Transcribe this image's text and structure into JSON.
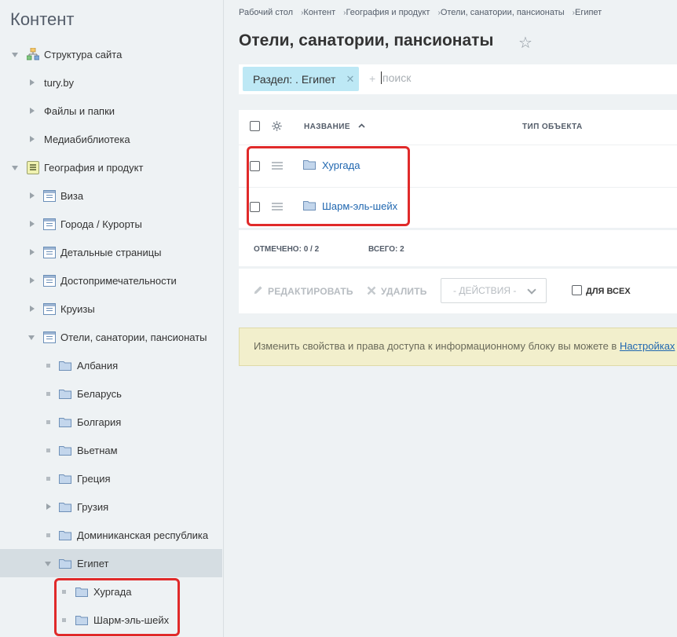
{
  "sidebar": {
    "title": "Контент",
    "items": [
      {
        "label": "Структура сайта",
        "icon": "site-structure-icon"
      },
      {
        "label": "tury.by"
      },
      {
        "label": "Файлы и папки"
      },
      {
        "label": "Медиабиблиотека"
      },
      {
        "label": "География и продукт",
        "icon": "infoblock-type-icon"
      },
      {
        "label": "Виза",
        "icon": "infoblock-list-icon"
      },
      {
        "label": "Города / Курорты",
        "icon": "infoblock-list-icon"
      },
      {
        "label": "Детальные страницы",
        "icon": "infoblock-list-icon"
      },
      {
        "label": "Достопримечательности",
        "icon": "infoblock-list-icon"
      },
      {
        "label": "Круизы",
        "icon": "infoblock-list-icon"
      },
      {
        "label": "Отели, санатории, пансионаты",
        "icon": "infoblock-list-icon"
      },
      {
        "label": "Албания",
        "icon": "folder-icon"
      },
      {
        "label": "Беларусь",
        "icon": "folder-icon"
      },
      {
        "label": "Болгария",
        "icon": "folder-icon"
      },
      {
        "label": "Вьетнам",
        "icon": "folder-icon"
      },
      {
        "label": "Греция",
        "icon": "folder-icon"
      },
      {
        "label": "Грузия",
        "icon": "folder-icon"
      },
      {
        "label": "Доминиканская республика",
        "icon": "folder-icon"
      },
      {
        "label": "Египет",
        "icon": "folder-icon"
      },
      {
        "label": "Хургада",
        "icon": "folder-icon"
      },
      {
        "label": "Шарм-эль-шейх",
        "icon": "folder-icon"
      }
    ]
  },
  "breadcrumb": [
    "Рабочий стол",
    "Контент",
    "География и продукт",
    "Отели, санатории, пансионаты",
    "Египет"
  ],
  "page": {
    "title": "Отели, санатории, пансионаты",
    "favorite_icon": "star-icon"
  },
  "filter": {
    "chip": "Раздел: . Египет",
    "plus": "+",
    "placeholder": "поиск"
  },
  "grid": {
    "columns": [
      "НАЗВАНИЕ",
      "ТИП ОБЪЕКТА"
    ],
    "rows": [
      {
        "name": "Хургада"
      },
      {
        "name": "Шарм-эль-шейх"
      }
    ],
    "footer": {
      "selected_label": "ОТМЕЧЕНО:",
      "selected_value": "0 / 2",
      "total_label": "ВСЕГО:",
      "total_value": "2"
    },
    "actions": {
      "edit": "РЕДАКТИРОВАТЬ",
      "delete": "УДАЛИТЬ",
      "select": "- ДЕЙСТВИЯ -",
      "for_all": "ДЛЯ ВСЕХ"
    }
  },
  "notice": {
    "text": "Изменить свойства и права доступа к информационному блоку вы можете в ",
    "link": "Настройках"
  },
  "colors": {
    "highlight": "#e02a2a",
    "link": "#2067b0",
    "chip": "#bde8f5"
  }
}
